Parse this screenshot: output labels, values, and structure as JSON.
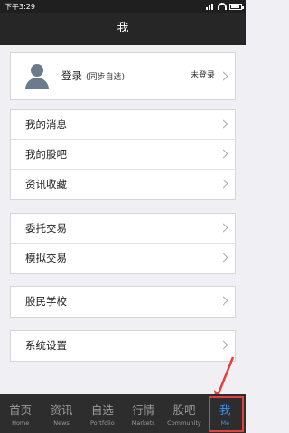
{
  "status": {
    "time": "下午3:29"
  },
  "header": {
    "title": "我"
  },
  "account": {
    "login_label": "登录",
    "login_sub": "(同步自选)",
    "status": "未登录"
  },
  "groups": [
    [
      "我的消息",
      "我的股吧",
      "资讯收藏"
    ],
    [
      "委托交易",
      "模拟交易"
    ],
    [
      "股民学校"
    ],
    [
      "系统设置"
    ]
  ],
  "tabs": [
    {
      "label": "首页",
      "sub": "Home"
    },
    {
      "label": "资讯",
      "sub": "News"
    },
    {
      "label": "自选",
      "sub": "Portfolio"
    },
    {
      "label": "行情",
      "sub": "Markets"
    },
    {
      "label": "股吧",
      "sub": "Community"
    },
    {
      "label": "我",
      "sub": "Me"
    }
  ],
  "colors": {
    "accent": "#3f8ff0",
    "highlight": "#e53e3e",
    "tab_bg": "#2d2d2d",
    "nav_bg": "#262626"
  },
  "icons": {
    "avatar": "user-avatar-icon",
    "chevron": "chevron-right-icon",
    "annotation": "red-arrow"
  },
  "active_tab": "我"
}
